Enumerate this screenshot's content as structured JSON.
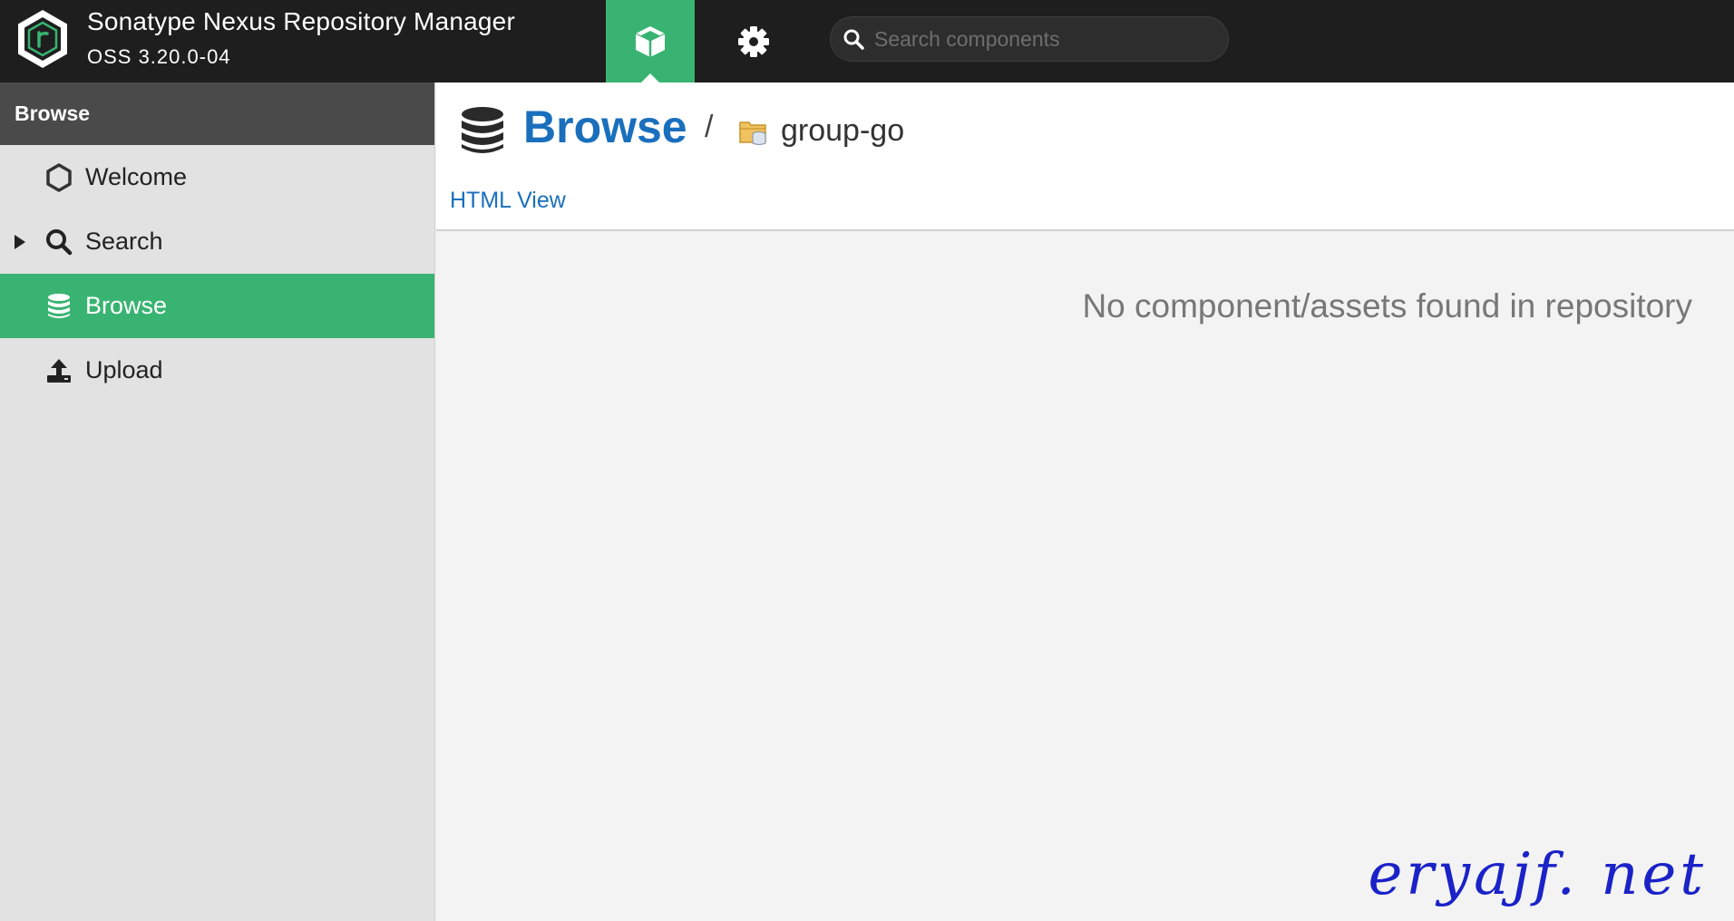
{
  "header": {
    "app_title": "Sonatype Nexus Repository Manager",
    "app_version": "OSS 3.20.0-04",
    "logo_icon": "nexus-hexagon-logo",
    "modes": [
      {
        "name": "browse",
        "icon": "cube-icon",
        "active": true
      },
      {
        "name": "administration",
        "icon": "gear-icon",
        "active": false
      }
    ],
    "search": {
      "placeholder": "Search components",
      "value": ""
    }
  },
  "sidebar": {
    "title": "Browse",
    "items": [
      {
        "label": "Welcome",
        "icon": "hexagon-icon",
        "active": false,
        "expandable": false
      },
      {
        "label": "Search",
        "icon": "search-icon",
        "active": false,
        "expandable": true
      },
      {
        "label": "Browse",
        "icon": "database-icon",
        "active": true,
        "expandable": false
      },
      {
        "label": "Upload",
        "icon": "upload-icon",
        "active": false,
        "expandable": false
      }
    ]
  },
  "main": {
    "title": "Browse",
    "separator": "/",
    "repository": "group-go",
    "html_view_link": "HTML View",
    "empty_message": "No component/assets found in repository"
  },
  "watermark": "eryajf. net",
  "colors": {
    "header_bg": "#1e1e1e",
    "accent_green": "#39b371",
    "link_blue": "#1a6fbd",
    "sidebar_bg": "#e2e2e2",
    "sidebar_header_bg": "#4a4a4a",
    "content_bg": "#f3f3f3"
  }
}
